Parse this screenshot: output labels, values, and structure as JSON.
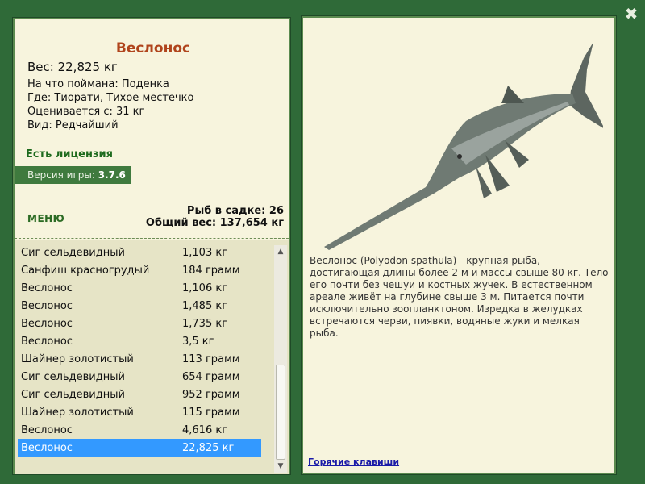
{
  "close_icon": "close-icon",
  "fish": {
    "name": "Веслонос",
    "weight": "Вес: 22,825 кг",
    "bait": "На что поймана: Поденка",
    "location": "Где: Тиорати, Тихое местечко",
    "value": "Оценивается с: 31 кг",
    "rarity": "Вид: Редчайший"
  },
  "license": "Есть лицензия",
  "version": {
    "label": "Версия игры:",
    "value": "3.7.6"
  },
  "menu_label": "МЕНЮ",
  "stats": {
    "fish_in_net": "Рыб в садке: 26",
    "total_weight": "Общий вес: 137,654 кг"
  },
  "catch_list": [
    {
      "name": "Сиг сельдевидный",
      "weight": "1,103 кг"
    },
    {
      "name": "Санфиш красногрудый",
      "weight": "184 грамм"
    },
    {
      "name": "Веслонос",
      "weight": "1,106 кг"
    },
    {
      "name": "Веслонос",
      "weight": "1,485 кг"
    },
    {
      "name": "Веслонос",
      "weight": "1,735 кг"
    },
    {
      "name": "Веслонос",
      "weight": "3,5 кг"
    },
    {
      "name": "Шайнер золотистый",
      "weight": "113 грамм"
    },
    {
      "name": "Сиг сельдевидный",
      "weight": "654 грамм"
    },
    {
      "name": "Сиг сельдевидный",
      "weight": "952 грамм"
    },
    {
      "name": "Шайнер золотистый",
      "weight": "115 грамм"
    },
    {
      "name": "Веслонос",
      "weight": "4,616 кг"
    },
    {
      "name": "Веслонос",
      "weight": "22,825 кг"
    }
  ],
  "selected_index": 11,
  "description": "Веслонос (Polyodon spathula) - крупная рыба, достигающая длины более 2 м и массы свыше 80 кг. Тело его почти без чешуи и костных жучек. В естественном ареале живёт на глубине свыше 3 м. Питается почти исключительно зоопланктоном. Изредка в желудках встречаются черви, пиявки, водяные жуки и мелкая рыба.",
  "hotkeys_label": "Горячие клавиши",
  "colors": {
    "background": "#2f6a38",
    "panel": "#f7f4dd",
    "fish_name": "#b0441c",
    "license": "#1d6a1d",
    "selection": "#3399ff",
    "link": "#1a1aa8"
  }
}
